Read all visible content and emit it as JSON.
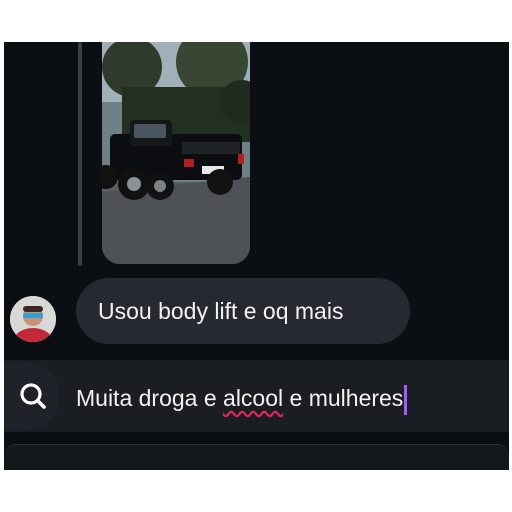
{
  "thread": {
    "image_alt": "",
    "incoming_message": "Usou body lift e oq mais"
  },
  "composer": {
    "text_before": "Muita droga e ",
    "misspelled_word": "alcool",
    "text_after": " e mulheres"
  },
  "colors": {
    "background": "#0b0f14",
    "bubble": "#26292f",
    "composer": "#1a1d22",
    "caret": "#a35cff",
    "spellcheck_underline": "#e0245e"
  }
}
